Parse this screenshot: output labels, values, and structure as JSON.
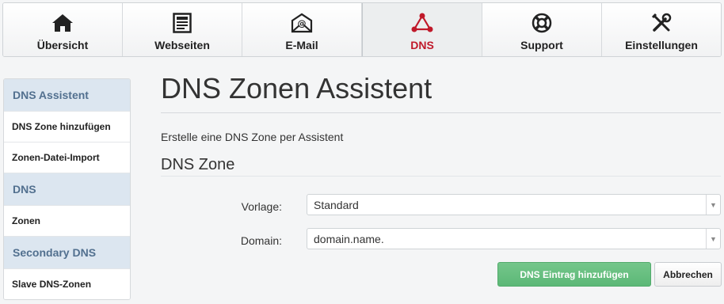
{
  "nav": {
    "tabs": [
      {
        "label": "Übersicht",
        "icon": "home-icon"
      },
      {
        "label": "Webseiten",
        "icon": "webpage-icon"
      },
      {
        "label": "E-Mail",
        "icon": "envelope-at-icon"
      },
      {
        "label": "DNS",
        "icon": "network-nodes-icon",
        "active": true
      },
      {
        "label": "Support",
        "icon": "lifebuoy-icon"
      },
      {
        "label": "Einstellungen",
        "icon": "tools-icon"
      }
    ]
  },
  "sidebar": {
    "sections": [
      {
        "title": "DNS Assistent",
        "items": [
          "DNS Zone hinzufügen",
          "Zonen-Datei-Import"
        ]
      },
      {
        "title": "DNS",
        "items": [
          "Zonen"
        ]
      },
      {
        "title": "Secondary DNS",
        "items": [
          "Slave DNS-Zonen"
        ]
      }
    ]
  },
  "main": {
    "title": "DNS Zonen Assistent",
    "intro": "Erstelle eine DNS Zone per Assistent",
    "section_title": "DNS Zone",
    "form": {
      "template_label": "Vorlage:",
      "template_value": "Standard",
      "domain_label": "Domain:",
      "domain_value": "domain.name."
    },
    "buttons": {
      "submit": "DNS Eintrag hinzufügen",
      "cancel": "Abbrechen"
    }
  },
  "colors": {
    "accent": "#c0192a",
    "success": "#5cb877",
    "sidebar_section_bg": "#dce6f0"
  }
}
